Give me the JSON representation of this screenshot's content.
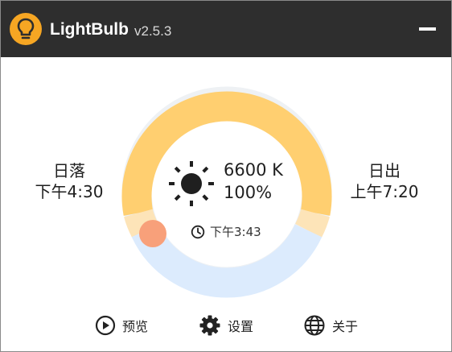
{
  "app": {
    "name": "LightBulb",
    "version": "v2.5.3"
  },
  "icons": {
    "app": "lightbulb-icon",
    "minimize": "minimize-icon",
    "sun": "sun-icon",
    "clock": "clock-icon",
    "preview": "play-circle-icon",
    "settings": "gear-icon",
    "about": "globe-icon"
  },
  "sunset": {
    "label": "日落",
    "time": "下午4:30"
  },
  "sunrise": {
    "label": "日出",
    "time": "上午7:20"
  },
  "status": {
    "temperature": "6600 K",
    "brightness": "100%",
    "current_time": "下午3:43"
  },
  "footer": {
    "preview_label": "预览",
    "settings_label": "设置",
    "about_label": "关于"
  },
  "colors": {
    "day": "#ffcf70",
    "night": "#dcebfd",
    "transition": "#fde4b8",
    "indicator": "#f8a07a",
    "titlebar": "#2e2e2e",
    "accent": "#f6a623"
  }
}
